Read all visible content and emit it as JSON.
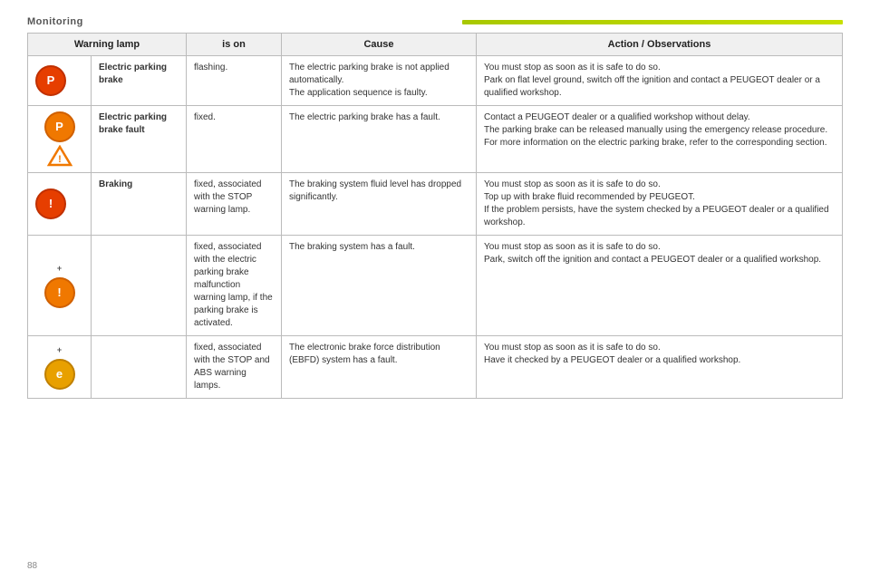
{
  "page": {
    "title": "Monitoring",
    "page_number": "88",
    "green_bar": true
  },
  "table": {
    "headers": [
      "Warning lamp",
      "is on",
      "Cause",
      "Action / Observations"
    ],
    "rows": [
      {
        "icon_type": "circle_red",
        "icon_label": "P",
        "warning_name": "Electric parking brake",
        "is_on": "flashing.",
        "cause": "The electric parking brake is not applied automatically.\nThe application sequence is faulty.",
        "action": "You must stop as soon as it is safe to do so.\nPark on flat level ground, switch off the ignition and contact a PEUGEOT dealer or a qualified workshop."
      },
      {
        "icon_type": "circle_orange_triangle",
        "icon_label": "P",
        "warning_name": "Electric parking brake fault",
        "is_on": "fixed.",
        "cause": "The electric parking brake has a fault.",
        "action": "Contact a PEUGEOT dealer or a qualified workshop without delay.\nThe parking brake can be released manually using the emergency release procedure.\nFor more information on the electric parking brake, refer to the corresponding section."
      },
      {
        "icon_type": "circle_red",
        "icon_label": "!",
        "warning_name": "Braking",
        "is_on": "fixed, associated with the STOP warning lamp.",
        "cause": "The braking system fluid level has dropped significantly.",
        "action": "You must stop as soon as it is safe to do so.\nTop up with brake fluid recommended by PEUGEOT.\nIf the problem persists, have the system checked by a PEUGEOT dealer or a qualified workshop."
      },
      {
        "icon_type": "plus_circle_orange",
        "icon_label": "!",
        "warning_name": "",
        "is_on": "fixed, associated with the electric parking brake malfunction warning lamp, if the parking brake is activated.",
        "cause": "The braking system has a fault.",
        "action": "You must stop as soon as it is safe to do so.\nPark, switch off the ignition and contact a PEUGEOT dealer or a qualified workshop."
      },
      {
        "icon_type": "plus_circle_yellow",
        "icon_label": "e",
        "warning_name": "",
        "is_on": "fixed, associated with the STOP and ABS warning lamps.",
        "cause": "The electronic brake force distribution (EBFD) system has a fault.",
        "action": "You must stop as soon as it is safe to do so.\nHave it checked by a PEUGEOT dealer or a qualified workshop."
      }
    ]
  }
}
